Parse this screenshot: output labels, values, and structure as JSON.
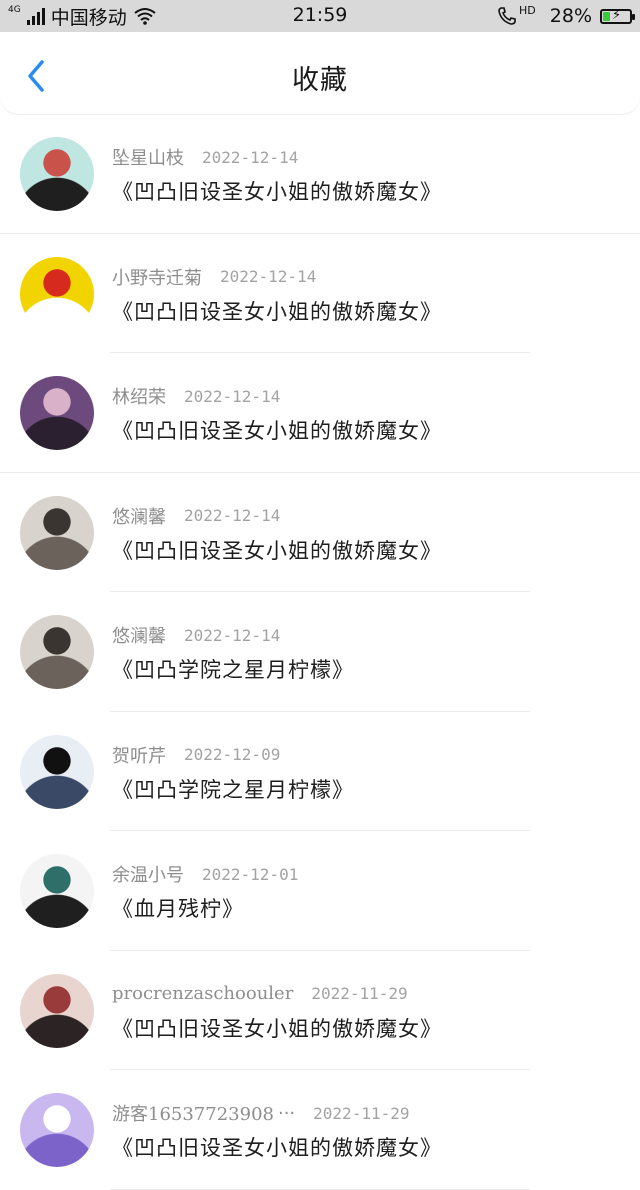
{
  "status_bar": {
    "network_type": "4G",
    "carrier": "中国移动",
    "time": "21:59",
    "hd_label": "HD",
    "battery_percent": "28%",
    "battery_level": 0.28,
    "battery_color": "#3cc93c"
  },
  "header": {
    "title": "收藏",
    "accent": "#2a8cf0"
  },
  "favorites": [
    {
      "author": "坠星山枝",
      "date": "2022-12-14",
      "work": "《凹凸旧设圣女小姐的傲娇魔女》",
      "avatar_icon": "anime-girl-red-hair-avatar",
      "colors": [
        "#bfe6e1",
        "#c9534a",
        "#1f1f1f"
      ]
    },
    {
      "author": "小野寺迁菊",
      "date": "2022-12-14",
      "work": "《凹凸旧设圣女小姐的傲娇魔女》",
      "avatar_icon": "fu-character-avatar",
      "colors": [
        "#f2d400",
        "#d72a1e",
        "#ffffff"
      ]
    },
    {
      "author": "林绍荣",
      "date": "2022-12-14",
      "work": "《凹凸旧设圣女小姐的傲娇魔女》",
      "avatar_icon": "purple-villain-avatar",
      "colors": [
        "#6d4a7d",
        "#d9b2c9",
        "#2b2030"
      ]
    },
    {
      "author": "悠澜馨",
      "date": "2022-12-14",
      "work": "《凹凸旧设圣女小姐的傲娇魔女》",
      "avatar_icon": "hooded-figure-avatar",
      "colors": [
        "#d8d3cc",
        "#3b3532",
        "#6b625b"
      ]
    },
    {
      "author": "悠澜馨",
      "date": "2022-12-14",
      "work": "《凹凸学院之星月柠檬》",
      "avatar_icon": "hooded-figure-avatar",
      "colors": [
        "#d8d3cc",
        "#3b3532",
        "#6b625b"
      ]
    },
    {
      "author": "贺听芹",
      "date": "2022-12-09",
      "work": "《凹凸学院之星月柠檬》",
      "avatar_icon": "dark-hair-boy-avatar",
      "colors": [
        "#e9eef5",
        "#111111",
        "#3a4a66"
      ]
    },
    {
      "author": "余温小号",
      "date": "2022-12-01",
      "work": "《血月残柠》",
      "avatar_icon": "anime-girl-standing-avatar",
      "colors": [
        "#f4f4f4",
        "#2f6f6a",
        "#1f1f1f"
      ]
    },
    {
      "author": "procrenzaschoouler",
      "date": "2022-11-29",
      "work": "《凹凸旧设圣女小姐的傲娇魔女》",
      "avatar_icon": "girl-photo-avatar",
      "colors": [
        "#e8d5cf",
        "#9a3b3b",
        "#2c2424"
      ]
    },
    {
      "author": "游客16537723908",
      "author_ellipsis": "···",
      "date": "2022-11-29",
      "work": "《凹凸旧设圣女小姐的傲娇魔女》",
      "avatar_icon": "cartoon-ghost-avatar",
      "colors": [
        "#c9b8f0",
        "#ffffff",
        "#7b63c9"
      ]
    }
  ]
}
